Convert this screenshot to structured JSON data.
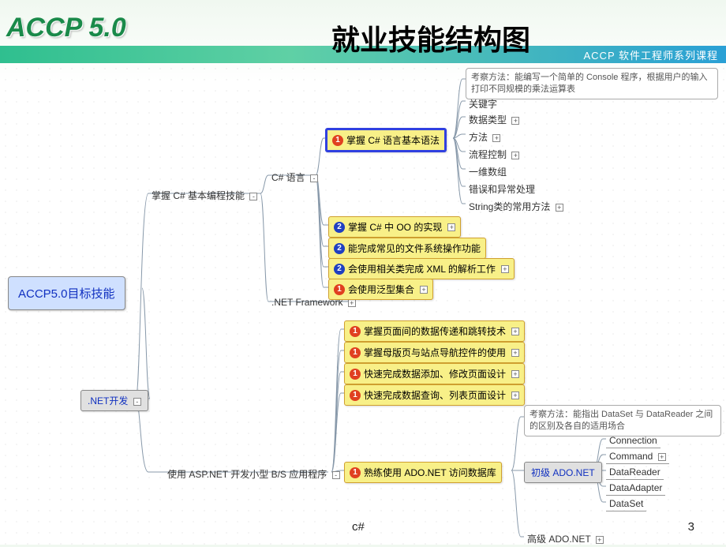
{
  "header": {
    "logo": "ACCP 5.0",
    "page_title": "就业技能结构图",
    "tagline": "ACCP 软件工程师系列课程"
  },
  "footer": {
    "text": "c#",
    "page_number": "3"
  },
  "diagram": {
    "root": "ACCP5.0目标技能",
    "net_dev": ".NET开发",
    "branch_skill": "掌握 C# 基本编程技能",
    "branch_csharp": "C# 语言",
    "branch_dotnet_fw": ".NET Framework",
    "branch_aspnet": "使用 ASP.NET 开发小型 B/S 应用程序",
    "csharp_topics": {
      "t1": {
        "badge": 1,
        "label": "掌握 C# 语言基本语法"
      },
      "t2": {
        "badge": 2,
        "label": "掌握 C# 中 OO 的实现"
      },
      "t3": {
        "badge": 2,
        "label": "能完成常见的文件系统操作功能"
      },
      "t4": {
        "badge": 2,
        "label": "会使用相关类完成 XML 的解析工作"
      },
      "t5": {
        "badge": 1,
        "label": "会使用泛型集合"
      }
    },
    "csharp_note": "考察方法：能编写一个简单的 Console\n程序，根据用户的输入打印不同规模的乘法运算表",
    "csharp_sub": {
      "s1": "关键字",
      "s2": "数据类型",
      "s3": "方法",
      "s4": "流程控制",
      "s5": "一维数组",
      "s6": "错误和异常处理",
      "s7": "String类的常用方法"
    },
    "dotnet_items": {
      "d1": {
        "badge": 1,
        "label": "掌握页面间的数据传递和跳转技术"
      },
      "d2": {
        "badge": 1,
        "label": "掌握母版页与站点导航控件的使用"
      },
      "d3": {
        "badge": 1,
        "label": "快速完成数据添加、修改页面设计"
      },
      "d4": {
        "badge": 1,
        "label": "快速完成数据查询、列表页面设计"
      }
    },
    "adonet": {
      "main": {
        "badge": 1,
        "label": "熟练使用 ADO.NET 访问数据库"
      },
      "note": "考察方法：能指出 DataSet 与 DataReader\n之间的区别及各自的适用场合",
      "primary": "初级 ADO.NET",
      "advanced": "高级 ADO.NET",
      "items": {
        "a1": "Connection",
        "a2": "Command",
        "a3": "DataReader",
        "a4": "DataAdapter",
        "a5": "DataSet"
      }
    }
  }
}
